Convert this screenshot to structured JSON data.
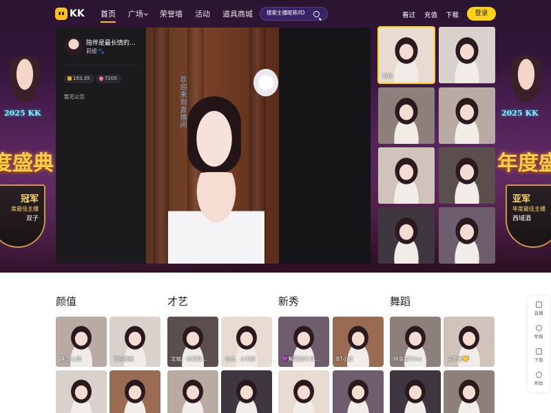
{
  "header": {
    "logo_text": "KK",
    "nav": [
      {
        "label": "首页",
        "active": true
      },
      {
        "label": "广场",
        "has_dropdown": true
      },
      {
        "label": "荣誉墙"
      },
      {
        "label": "活动"
      },
      {
        "label": "道具商城"
      }
    ],
    "search_placeholder": "搜索主播昵称/ID",
    "links": [
      "看过",
      "充值",
      "下载"
    ],
    "login_label": "登录"
  },
  "banner": {
    "left": {
      "year_text": "2025 KK",
      "title": "度盛典",
      "rank": "冠军",
      "rank_sub": "度最佳主播",
      "winner": "双子"
    },
    "right": {
      "year_text": "2025 KK",
      "title": "年度盛",
      "rank": "亚军",
      "rank_sub": "年度最佳主播",
      "winner": "西域酒"
    }
  },
  "player": {
    "title": "陪伴是最长情的…",
    "anchor_name": "莉娅",
    "coins": "193.35",
    "fans": "7205",
    "notice": "暂无公告",
    "overlay_text": "欢迎来到直播间"
  },
  "live_thumbs": [
    {
      "label": "莉娅",
      "active": true,
      "tone": "bg-i"
    },
    {
      "label": "",
      "tone": "bg-c"
    },
    {
      "label": "",
      "tone": "bg-b"
    },
    {
      "label": "",
      "tone": "bg-e"
    },
    {
      "label": "",
      "tone": "bg-a"
    },
    {
      "label": "",
      "tone": "bg-d"
    },
    {
      "label": "",
      "tone": "bg-h"
    },
    {
      "label": "",
      "tone": "bg-g"
    }
  ],
  "sections": [
    {
      "title": "颜值",
      "cards": [
        "静·恋心筵",
        "橙宜困困",
        "",
        ""
      ]
    },
    {
      "title": "才艺",
      "cards": [
        "龙城、林清贺…",
        "龙城、小米酥",
        "",
        ""
      ]
    },
    {
      "title": "新秀",
      "cards": [
        "💜紫菜谢天书…",
        "BT小舒",
        "",
        ""
      ]
    },
    {
      "title": "舞蹈",
      "cards": [
        "林语晨Time",
        "陈梦曦💛",
        "",
        ""
      ]
    }
  ],
  "tools": [
    "直播",
    "举报",
    "下载",
    "帮助"
  ]
}
